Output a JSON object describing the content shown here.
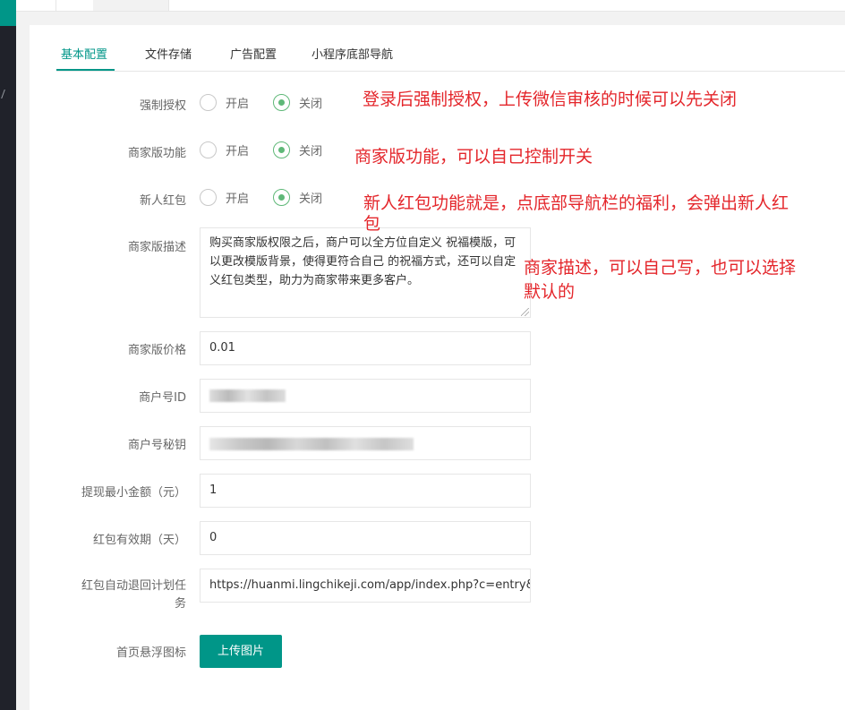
{
  "tabs": [
    "基本配置",
    "文件存储",
    "广告配置",
    "小程序底部导航"
  ],
  "labels": {
    "force_auth": "强制授权",
    "merchant_feature": "商家版功能",
    "new_user_redpacket": "新人红包",
    "merchant_desc": "商家版描述",
    "merchant_price": "商家版价格",
    "merchant_id": "商户号ID",
    "merchant_key": "商户号秘钥",
    "min_withdraw": "提现最小金额（元）",
    "redpacket_valid": "红包有效期（天）",
    "redpacket_refund_line1": "红包自动退回计划任",
    "redpacket_refund_line2": "务",
    "float_icon": "首页悬浮图标"
  },
  "radio": {
    "on": "开启",
    "off": "关闭"
  },
  "values": {
    "merchant_desc": "购买商家版权限之后，商户可以全方位自定义 祝福模版，可以更改模版背景，使得更符合自己 的祝福方式，还可以自定义红包类型，助力为商家带来更多客户。",
    "merchant_price": "0.01",
    "min_withdraw": "1",
    "redpacket_valid": "0",
    "redpacket_refund_url": "https://huanmi.lingchikeji.com/app/index.php?c=entry&a=wxapp&do=refund"
  },
  "upload_button": "上传图片",
  "notes": {
    "force_auth": "登录后强制授权，上传微信审核的时候可以先关闭",
    "merchant_feature": "商家版功能，可以自己控制开关",
    "new_user_redpacket_line1": "新人红包功能就是，点底部导航栏的福利，会弹出新人红",
    "new_user_redpacket_line2": "包",
    "merchant_desc_line1": "商家描述，可以自己写，也可以选择",
    "merchant_desc_line2": "默认的"
  },
  "colors": {
    "accent": "#009688",
    "radio_checked": "#5fb878",
    "annotation": "#e4262b"
  }
}
